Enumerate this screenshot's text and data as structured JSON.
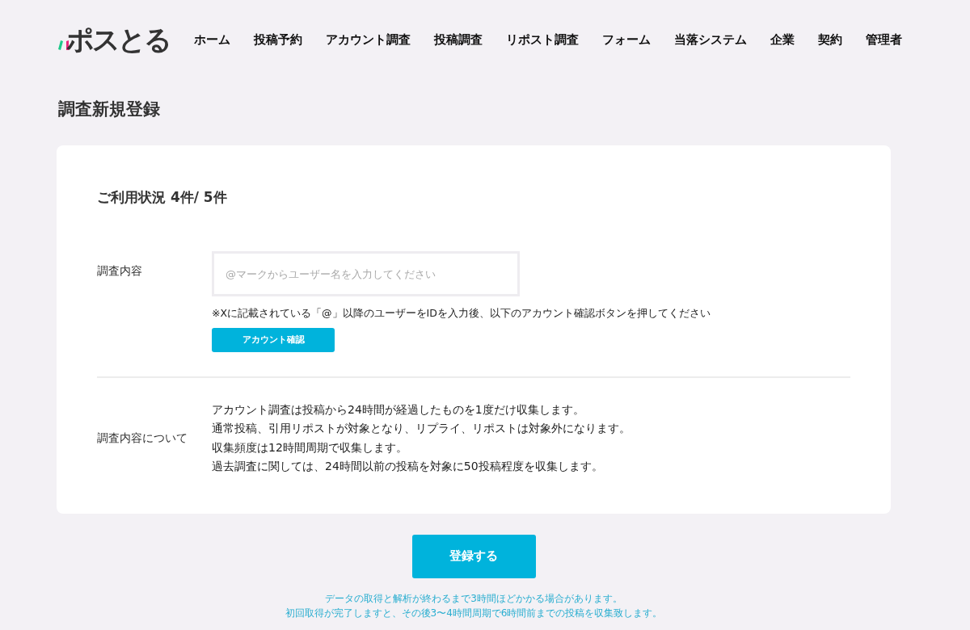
{
  "logo": "ポスとる",
  "nav": [
    {
      "label": "ホーム"
    },
    {
      "label": "投稿予約"
    },
    {
      "label": "アカウント調査"
    },
    {
      "label": "投稿調査"
    },
    {
      "label": "リポスト調査"
    },
    {
      "label": "フォーム"
    },
    {
      "label": "当落システム"
    },
    {
      "label": "企業"
    },
    {
      "label": "契約"
    },
    {
      "label": "管理者"
    }
  ],
  "page_title": "調査新規登録",
  "usage": "ご利用状況 4件/ 5件",
  "form": {
    "label": "調査内容",
    "placeholder": "@マークからユーザー名を入力してください",
    "note": "※Xに記載されている「@」以降のユーザーをIDを入力後、以下のアカウント確認ボタンを押してください",
    "check_button": "アカウント確認"
  },
  "about": {
    "label": "調査内容について",
    "lines": [
      "アカウント調査は投稿から24時間が経過したものを1度だけ収集します。",
      "通常投稿、引用リポストが対象となり、リプライ、リポストは対象外になります。",
      "収集頻度は12時間周期で収集します。",
      "過去調査に関しては、24時間以前の投稿を対象に50投稿程度を収集します。"
    ]
  },
  "submit_button": "登録する",
  "footer_notes": [
    "データの取得と解析が終わるまで3時間ほどかかる場合があります。",
    "初回取得が完了しますと、その後3〜4時間周期で6時間前までの投稿を収集致します。"
  ]
}
